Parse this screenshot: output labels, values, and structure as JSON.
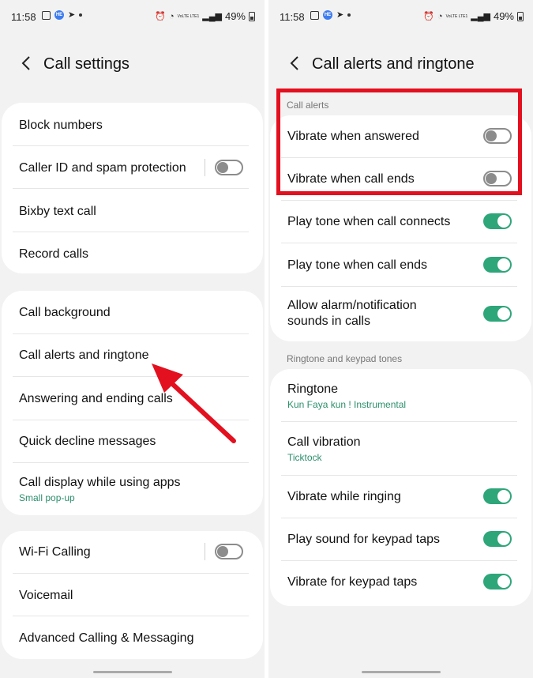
{
  "colors": {
    "accent": "#2ea67a",
    "highlight": "#e3101f",
    "toggle_off": "#8c8c8c"
  },
  "left": {
    "status": {
      "time": "11:58",
      "battery": "49%",
      "signal": "VoLTE LTE1"
    },
    "header": {
      "title": "Call settings"
    },
    "group1": [
      {
        "label": "Block numbers"
      },
      {
        "label": "Caller ID and spam protection",
        "toggle": false
      },
      {
        "label": "Bixby text call"
      },
      {
        "label": "Record calls"
      }
    ],
    "group2": [
      {
        "label": "Call background"
      },
      {
        "label": "Call alerts and ringtone"
      },
      {
        "label": "Answering and ending calls"
      },
      {
        "label": "Quick decline messages"
      },
      {
        "label": "Call display while using apps",
        "sub": "Small pop-up"
      }
    ],
    "group3": [
      {
        "label": "Wi-Fi Calling",
        "toggle": false
      },
      {
        "label": "Voicemail"
      },
      {
        "label": "Advanced Calling & Messaging"
      }
    ]
  },
  "right": {
    "status": {
      "time": "11:58",
      "battery": "49%",
      "signal": "VoLTE LTE1"
    },
    "header": {
      "title": "Call alerts and ringtone"
    },
    "section1": "Call alerts",
    "alerts": [
      {
        "label": "Vibrate when answered",
        "toggle": false
      },
      {
        "label": "Vibrate when call ends",
        "toggle": false
      },
      {
        "label": "Play tone when call connects",
        "toggle": true
      },
      {
        "label": "Play tone when call ends",
        "toggle": true
      },
      {
        "label": "Allow alarm/notification",
        "label2": "sounds in calls",
        "toggle": true
      }
    ],
    "section2": "Ringtone and keypad tones",
    "tones": [
      {
        "label": "Ringtone",
        "sub": "Kun Faya kun ! Instrumental"
      },
      {
        "label": "Call vibration",
        "sub": "Ticktock"
      },
      {
        "label": "Vibrate while ringing",
        "toggle": true
      },
      {
        "label": "Play sound for keypad taps",
        "toggle": true
      },
      {
        "label": "Vibrate for keypad taps",
        "toggle": true
      }
    ]
  }
}
